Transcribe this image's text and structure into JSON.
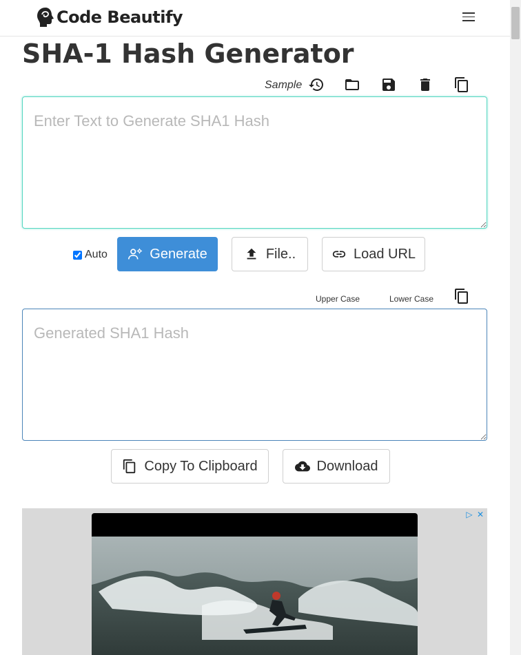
{
  "header": {
    "logo_text": "Code Beautify",
    "menu_icon": "hamburger-menu-icon"
  },
  "page": {
    "title": "SHA-1 Hash Generator"
  },
  "toolbar": {
    "sample_label": "Sample",
    "icons": [
      "history-icon",
      "folder-open-icon",
      "save-icon",
      "trash-icon",
      "copy-icon"
    ]
  },
  "input": {
    "placeholder": "Enter Text to Generate SHA1 Hash",
    "value": ""
  },
  "controls": {
    "auto_label": "Auto",
    "auto_checked": true,
    "generate_label": "Generate",
    "file_label": "File..",
    "load_url_label": "Load URL"
  },
  "output_toolbar": {
    "upper_case_label": "Upper Case",
    "lower_case_label": "Lower Case"
  },
  "output": {
    "placeholder": "Generated SHA1 Hash",
    "value": ""
  },
  "output_actions": {
    "copy_label": "Copy To Clipboard",
    "download_label": "Download"
  },
  "ad": {
    "adchoices_icon": "ad-choices-icon",
    "close_icon": "close-icon"
  },
  "colors": {
    "primary": "#3e8ed8",
    "input_focus_border": "#57d6c1",
    "output_border": "#4a84b8"
  }
}
